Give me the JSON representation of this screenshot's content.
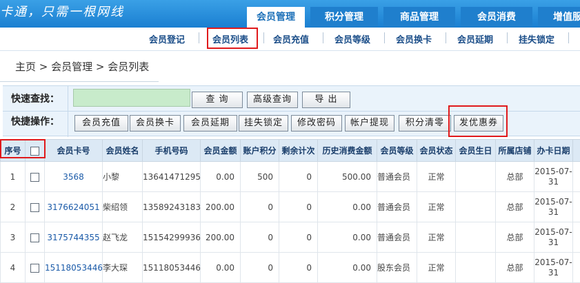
{
  "header": {
    "slogan": "卡通，只需一根网线",
    "tabs": [
      {
        "label": "会员管理",
        "active": true
      },
      {
        "label": "积分管理",
        "active": false
      },
      {
        "label": "商品管理",
        "active": false
      },
      {
        "label": "会员消费",
        "active": false
      },
      {
        "label": "增值服务",
        "active": false
      }
    ]
  },
  "subnav": {
    "items": [
      "会员登记",
      "会员列表",
      "会员充值",
      "会员等级",
      "会员换卡",
      "会员延期",
      "挂失锁定"
    ],
    "active": "会员列表"
  },
  "breadcrumb": {
    "text": "主页 > 会员管理 > 会员列表"
  },
  "quick": {
    "search_label": "快速查找：",
    "search_value": "",
    "query_button": "查 询",
    "advanced_button": "高级查询",
    "export_button": "导 出",
    "ops_label": "快捷操作：",
    "ops": [
      "会员充值",
      "会员换卡",
      "会员延期",
      "挂失锁定",
      "修改密码",
      "帐户提现",
      "积分清零",
      "发优惠券"
    ]
  },
  "table": {
    "columns": [
      "序号",
      "",
      "会员卡号",
      "会员姓名",
      "手机号码",
      "会员金额",
      "账户积分",
      "剩余计次",
      "历史消费金额",
      "会员等级",
      "会员状态",
      "会员生日",
      "所属店铺",
      "办卡日期",
      "办"
    ],
    "rows": [
      {
        "index": "1",
        "card": "3568",
        "name": "小黎",
        "phone": "13641471295",
        "amount": "0.00",
        "points": "500",
        "remaining": "0",
        "history": "500.00",
        "level": "普通会员",
        "status": "正常",
        "birthday": "",
        "store": "总部",
        "date": "2015-07-31"
      },
      {
        "index": "2",
        "card": "3176624051",
        "name": "柴绍领",
        "phone": "13589243183",
        "amount": "200.00",
        "points": "0",
        "remaining": "0",
        "history": "0.00",
        "level": "普通会员",
        "status": "正常",
        "birthday": "",
        "store": "总部",
        "date": "2015-07-31"
      },
      {
        "index": "3",
        "card": "3175744355",
        "name": "赵飞龙",
        "phone": "15154299936",
        "amount": "200.00",
        "points": "0",
        "remaining": "0",
        "history": "0.00",
        "level": "普通会员",
        "status": "正常",
        "birthday": "",
        "store": "总部",
        "date": "2015-07-31"
      },
      {
        "index": "4",
        "card": "15118053446",
        "name": "李大琛",
        "phone": "15118053446",
        "amount": "0.00",
        "points": "0",
        "remaining": "0",
        "history": "0.00",
        "level": "股东会员",
        "status": "正常",
        "birthday": "",
        "store": "总部",
        "date": "2015-07-31"
      }
    ]
  },
  "colors": {
    "header_blue": "#1a7fd1",
    "highlight_red": "#e0191b",
    "search_green": "#c8ebcb",
    "link_blue": "#1a5aa8"
  }
}
